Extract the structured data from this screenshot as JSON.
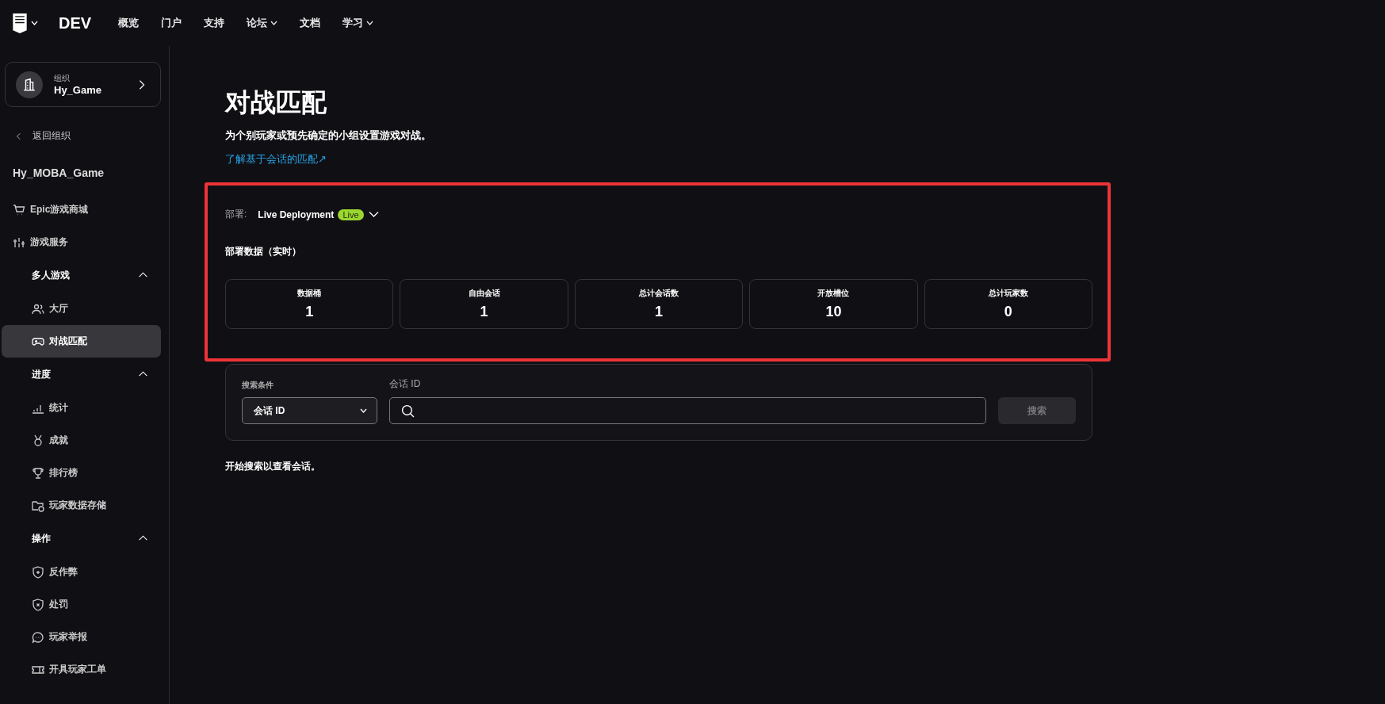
{
  "nav": {
    "logo_menu": true,
    "brand": "DEV",
    "links": [
      {
        "label": "概览",
        "dropdown": false
      },
      {
        "label": "门户",
        "dropdown": false
      },
      {
        "label": "支持",
        "dropdown": false
      },
      {
        "label": "论坛",
        "dropdown": true
      },
      {
        "label": "文档",
        "dropdown": false
      },
      {
        "label": "学习",
        "dropdown": true
      }
    ]
  },
  "sidebar": {
    "org": {
      "label": "组织",
      "name": "Hy_Game"
    },
    "back": "返回组织",
    "project": "Hy_MOBA_Game",
    "items": [
      {
        "label": "Epic游戏商城",
        "selected": false
      },
      {
        "label": "游戏服务",
        "selected": false
      }
    ],
    "sections": [
      {
        "title": "多人游戏",
        "expanded": true,
        "items": [
          {
            "label": "大厅",
            "selected": false
          },
          {
            "label": "对战匹配",
            "selected": true
          }
        ]
      },
      {
        "title": "进度",
        "expanded": true,
        "items": [
          {
            "label": "统计",
            "selected": false
          },
          {
            "label": "成就",
            "selected": false
          },
          {
            "label": "排行榜",
            "selected": false
          },
          {
            "label": "玩家数据存储",
            "selected": false
          }
        ]
      },
      {
        "title": "操作",
        "expanded": true,
        "items": [
          {
            "label": "反作弊",
            "selected": false
          },
          {
            "label": "处罚",
            "selected": false
          },
          {
            "label": "玩家举报",
            "selected": false
          },
          {
            "label": "开具玩家工单",
            "selected": false
          }
        ]
      }
    ]
  },
  "main": {
    "title": "对战匹配",
    "subtitle": "为个别玩家或预先确定的小组设置游戏对战。",
    "link": "了解基于会话的匹配↗",
    "deployment": {
      "label": "部署:",
      "name": "Live Deployment",
      "badge": "Live"
    },
    "stats_title": "部署数据（实时）",
    "stats": [
      {
        "label": "数据桶",
        "value": "1"
      },
      {
        "label": "自由会话",
        "value": "1"
      },
      {
        "label": "总计会话数",
        "value": "1"
      },
      {
        "label": "开放槽位",
        "value": "10"
      },
      {
        "label": "总计玩家数",
        "value": "0"
      }
    ],
    "search": {
      "criteria_label": "搜索条件",
      "criteria_value": "会话 ID",
      "field_label": "会话 ID",
      "button": "搜索",
      "button_disabled": true
    },
    "empty_message": "开始搜索以查看会话。",
    "annotation": {
      "kind": "outline"
    }
  }
}
